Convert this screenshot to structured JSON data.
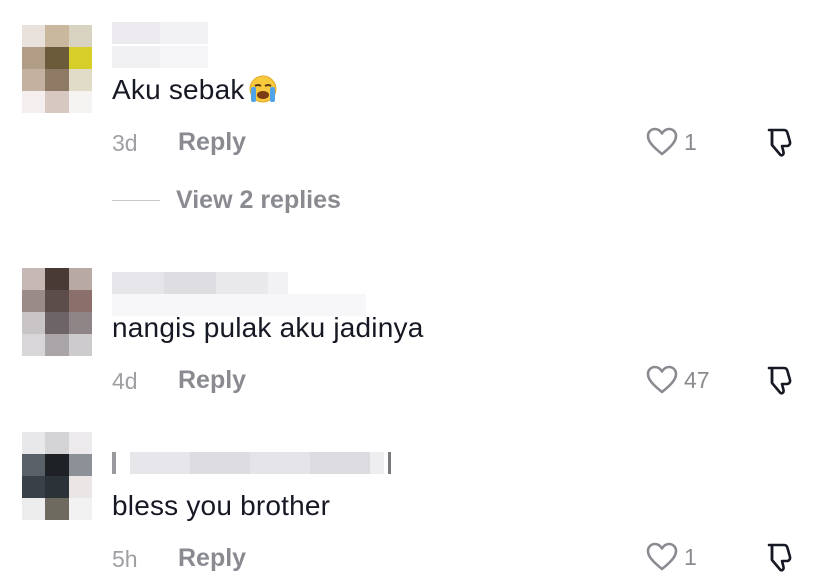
{
  "comments": [
    {
      "text": "Aku sebak",
      "emoji": "loudly-crying-face",
      "time": "3d",
      "reply_label": "Reply",
      "likes": "1",
      "view_replies": "View 2 replies"
    },
    {
      "text": "nangis pulak aku jadinya",
      "time": "4d",
      "reply_label": "Reply",
      "likes": "47"
    },
    {
      "text": "bless you brother",
      "time": "5h",
      "reply_label": "Reply",
      "likes": "1"
    }
  ],
  "colors": {
    "text": "#161823",
    "secondary": "#8a8b91",
    "timestamp": "#a0a0a4"
  },
  "icons": {
    "like": "heart-outline-icon",
    "dislike": "thumbs-down-icon"
  }
}
